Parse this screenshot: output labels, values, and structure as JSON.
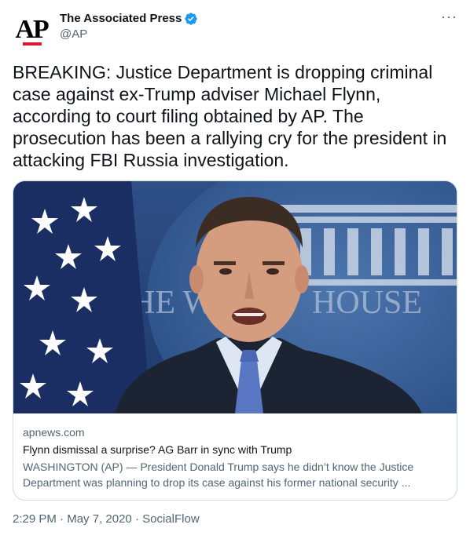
{
  "author": {
    "display_name": "The Associated Press",
    "handle": "@AP",
    "avatar_text": "AP",
    "verified_icon": "verified-badge-icon"
  },
  "more_icon": "more-horizontal-icon",
  "tweet": {
    "text": "BREAKING: Justice Department is dropping criminal\ncase against ex-Trump adviser Michael Flynn,\naccording to court filing obtained by AP.  The\nprosecution has been a rallying cry for the president in\nattacking FBI Russia investigation."
  },
  "link_card": {
    "domain": "apnews.com",
    "title": "Flynn dismissal a surprise? AG Barr in sync with Trump",
    "description_line1": "WASHINGTON (AP) — President Donald Trump says he didn’t know the Justice",
    "description_line2": "Department was planning to drop its case against his former national security ..."
  },
  "meta": {
    "time": "2:29 PM",
    "sep1": " · ",
    "date": "May 7, 2020",
    "sep2": " · ",
    "source": "SocialFlow"
  },
  "colors": {
    "verified": "#1d9bf0",
    "ap_red": "#e3142d",
    "secondary_text": "#536471",
    "border": "#cfd9de"
  }
}
